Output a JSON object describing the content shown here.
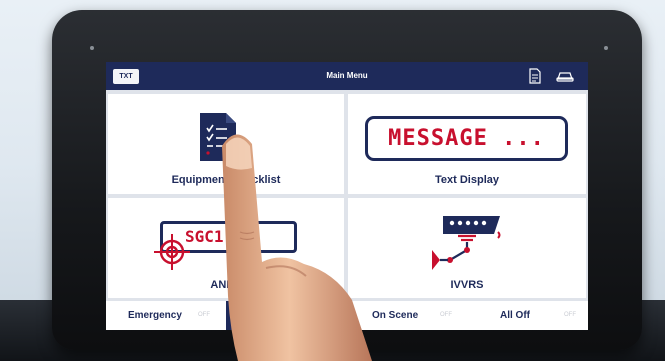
{
  "header": {
    "txt_button": "TXT",
    "title": "Main Menu",
    "icons": [
      "document-icon",
      "car-icon"
    ]
  },
  "tiles": {
    "equipment_checklist": {
      "label": "Equipment Checklist",
      "icon": "clipboard-checklist-icon"
    },
    "text_display": {
      "label": "Text Display",
      "message": "MESSAGE ..."
    },
    "anpr": {
      "label": "ANPR",
      "plate_text": "SGC1",
      "icon": "crosshair-icon"
    },
    "ivvrs": {
      "label": "IVVRS",
      "icon": "camera-mount-icon"
    }
  },
  "bottom_bar": {
    "emergency": {
      "label": "Emergency",
      "state": "OFF"
    },
    "on_scene": {
      "label": "On Scene",
      "state": "OFF"
    },
    "all_off": {
      "label": "All Off",
      "state": "OFF"
    }
  },
  "colors": {
    "navy": "#1e2a5a",
    "accent_red": "#c8102e",
    "tile_bg": "#ffffff",
    "grid_gap": "#dfe3ea"
  }
}
